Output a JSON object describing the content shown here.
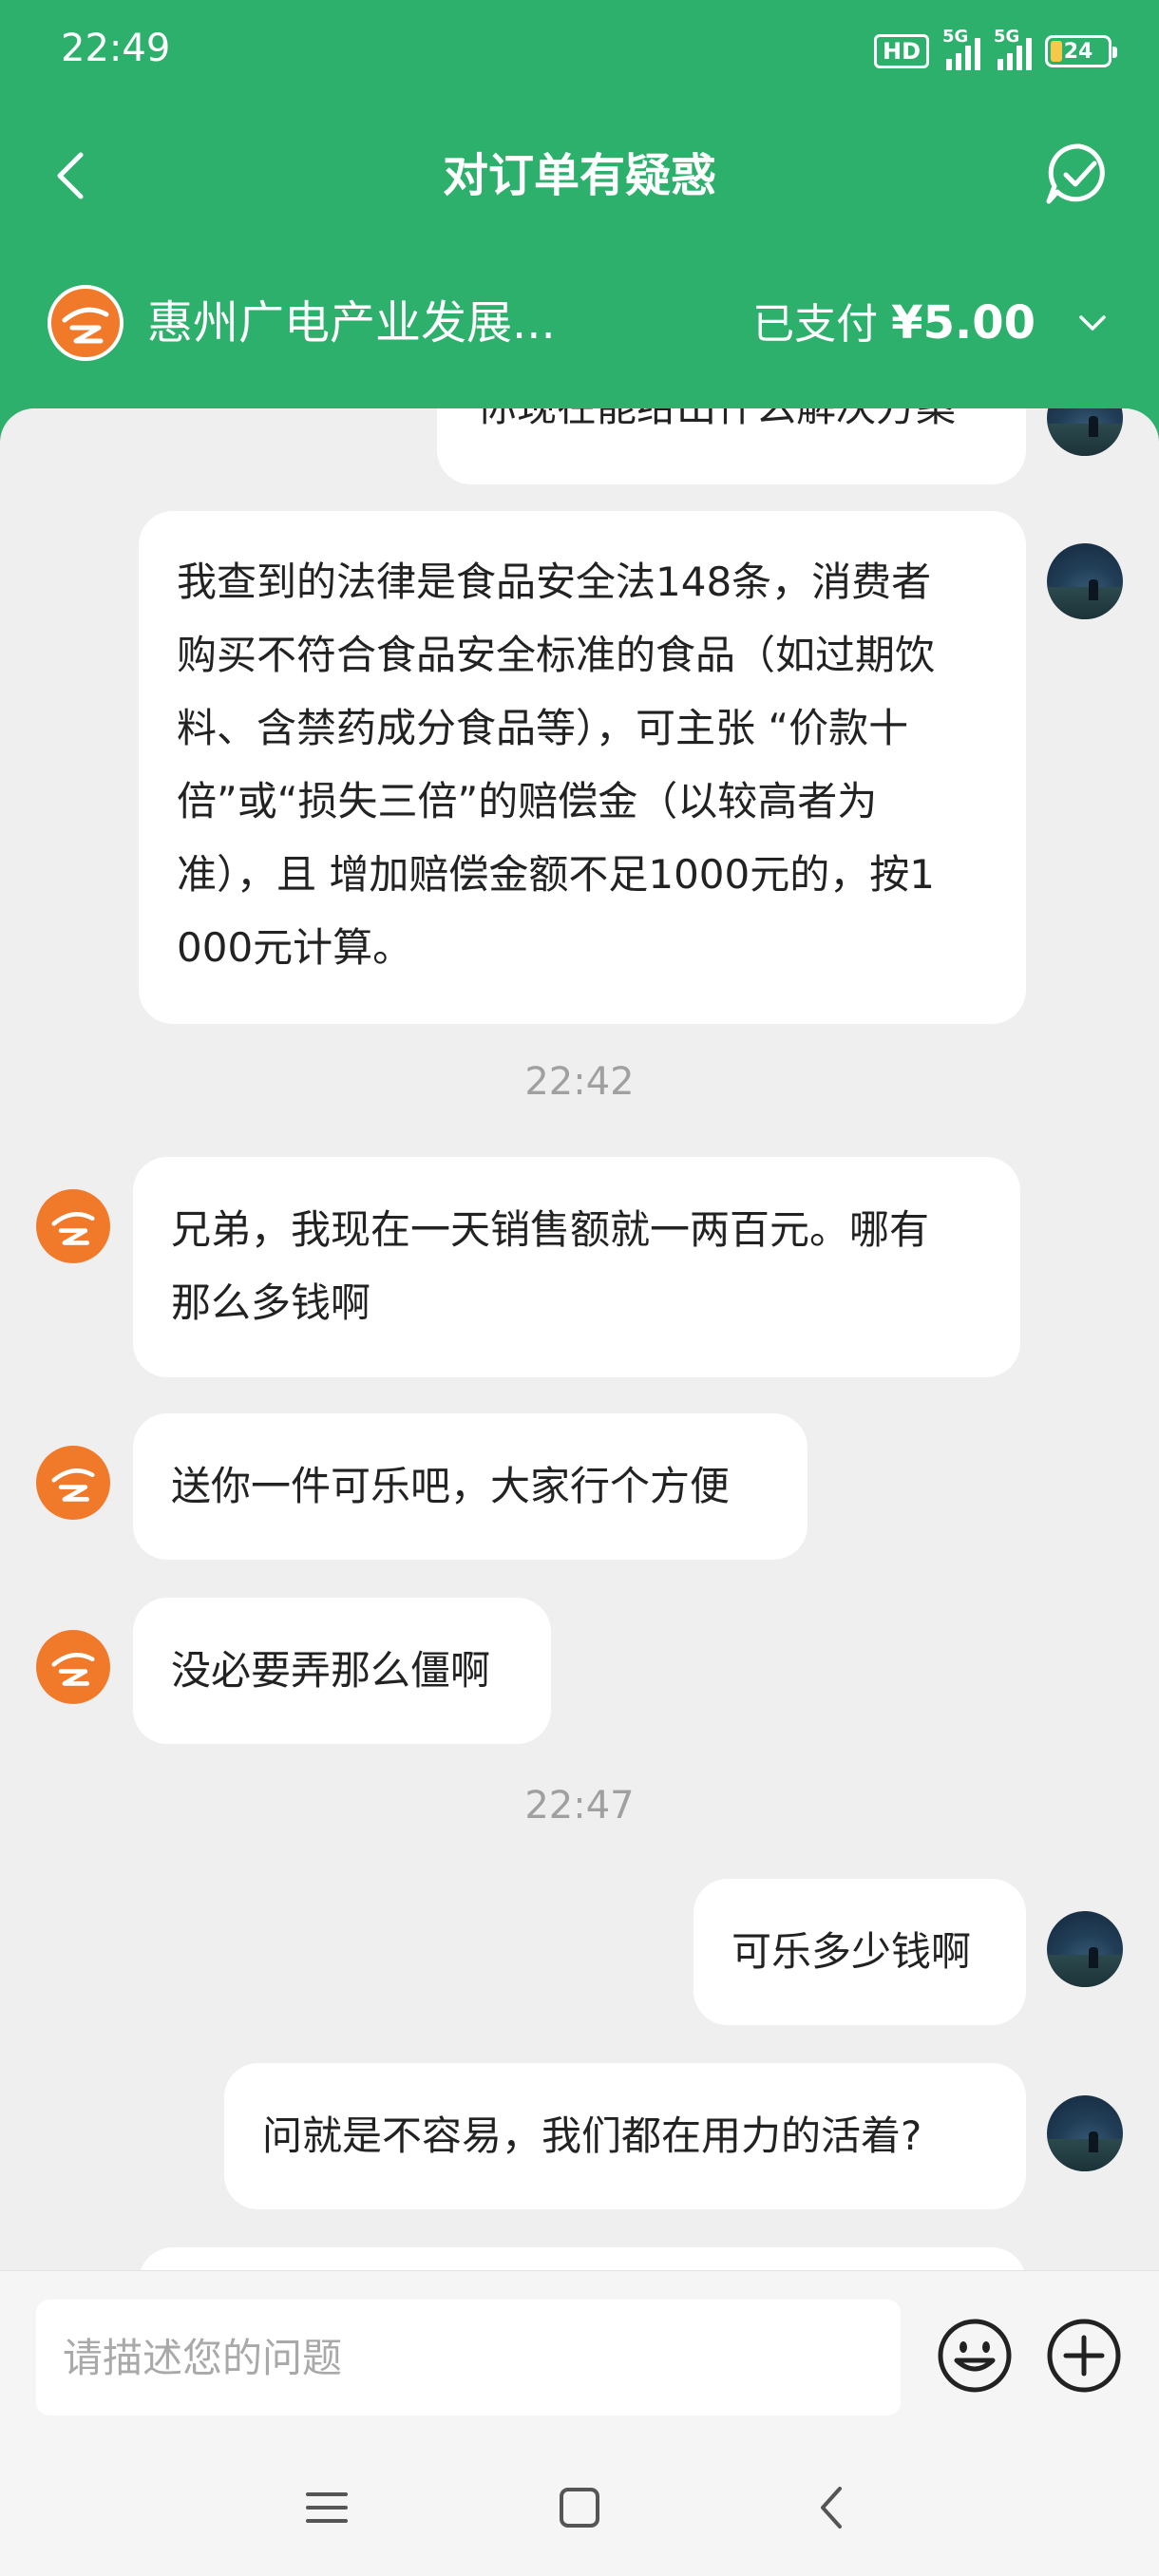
{
  "status_bar": {
    "time": "22:49",
    "hd": "HD",
    "sim1": "5G",
    "sim2": "5G",
    "battery": "24"
  },
  "header": {
    "title": "对订单有疑惑"
  },
  "store": {
    "name": "惠州广电产业发展...",
    "paid_label": "已支付",
    "paid_amount": "¥5.00"
  },
  "messages": [
    {
      "from": "user",
      "text": "你现在能给出什么解决方案"
    },
    {
      "from": "user",
      "text": "我查到的法律是食品安全法148条，消费者\n购买不符合食品安全标准的食品（如过期饮\n料、含禁药成分食品等），可主张 “价款十\n倍”或“损失三倍”的赔偿金（以较高者为\n准），且 增加赔偿金额不足1000元的，按1\n000元计算。"
    },
    {
      "from": "time",
      "text": "22:42"
    },
    {
      "from": "store",
      "text": "兄弟，我现在一天销售额就一两百元。哪有\n那么多钱啊"
    },
    {
      "from": "store",
      "text": "送你一件可乐吧，大家行个方便"
    },
    {
      "from": "store",
      "text": "没必要弄那么僵啊"
    },
    {
      "from": "time",
      "text": "22:47"
    },
    {
      "from": "user",
      "text": "可乐多少钱啊"
    },
    {
      "from": "user",
      "text": "问就是不容易，我们都在用力的活着?"
    }
  ],
  "input": {
    "placeholder": "请描述您的问题"
  },
  "colors": {
    "header_green": "#2db06b",
    "store_orange": "#f07a2a",
    "bubble": "#ffffff",
    "chat_bg": "#efefef"
  },
  "icons": {
    "back": "chevron-left-icon",
    "resolved": "chat-check-icon",
    "dropdown": "chevron-down-icon",
    "emoji": "smiley-icon",
    "plus": "plus-circle-icon",
    "nav_menu": "menu-icon",
    "nav_home": "square-icon",
    "nav_back": "back-triangle-icon"
  }
}
